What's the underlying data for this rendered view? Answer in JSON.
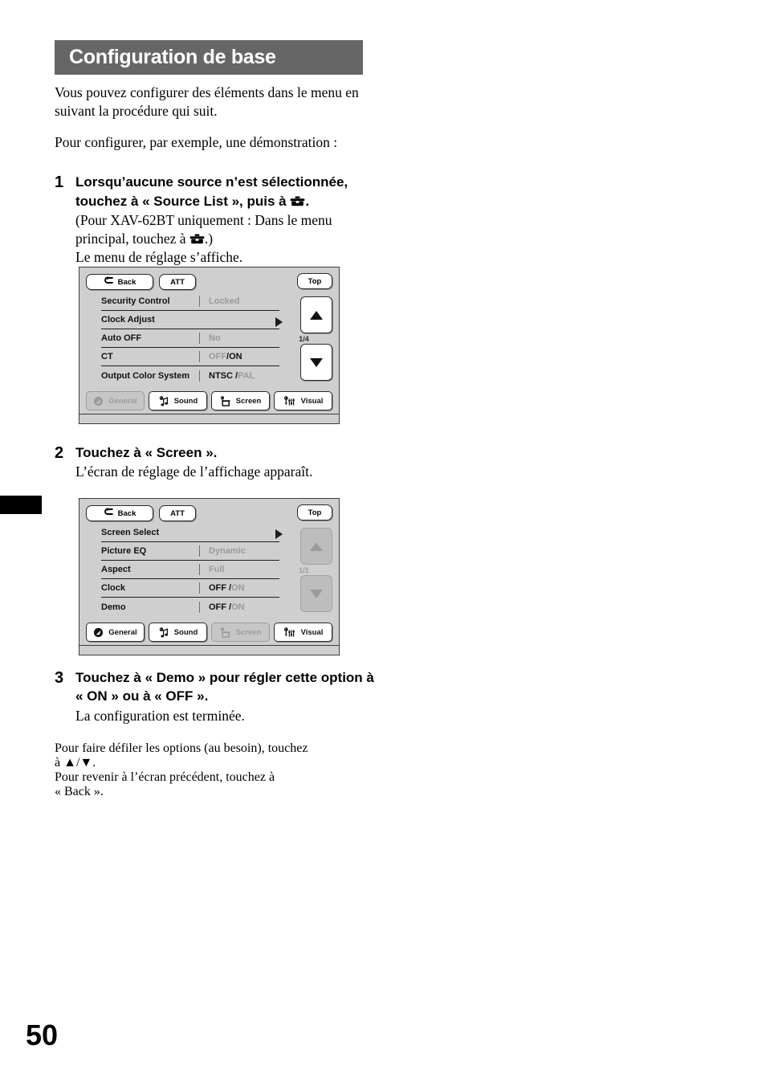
{
  "header": {
    "title": "Configuration de base"
  },
  "intro": {
    "p1": "Vous pouvez configurer des éléments dans le menu en suivant la procédure qui suit.",
    "p2": "Pour configurer, par exemple, une démonstration :"
  },
  "steps": [
    {
      "num": "1",
      "head_a": "Lorsqu’aucune source n’est sélectionnée, touchez à « Source List », puis à ",
      "head_b": ".",
      "sub_a": "(Pour XAV-62BT uniquement : Dans le menu principal, touchez à ",
      "sub_b": ".)",
      "sub2": "Le menu de réglage s’affiche."
    },
    {
      "num": "2",
      "head": "Touchez à « Screen ».",
      "sub": "L’écran de réglage de l’affichage apparaît."
    },
    {
      "num": "3",
      "head": "Touchez à « Demo » pour régler cette option à « ON » ou à « OFF ».",
      "sub": "La configuration est terminée."
    }
  ],
  "outro": {
    "l1": "Pour faire défiler les options (au besoin), touchez",
    "l2": "à ▲/▼.",
    "l3": "Pour revenir à l’écran précédent, touchez à",
    "l4": "« Back »."
  },
  "page_number": "50",
  "screen1": {
    "back_label": "Back",
    "att_label": "ATT",
    "top_label": "Top",
    "page_indicator": "1/4",
    "rows": [
      {
        "label": "Security Control",
        "value": "Locked",
        "state": "off",
        "separator": true
      },
      {
        "label": "Clock Adjust",
        "value": "",
        "state": "off",
        "separator": false
      },
      {
        "label": "Auto OFF",
        "value": "No",
        "state": "off",
        "separator": true
      },
      {
        "label": "CT",
        "value_off": "OFF",
        "value_sep": " / ",
        "value_on": "ON",
        "state": "mixed-on-right",
        "separator": true
      },
      {
        "label": "Output Color System",
        "value_on": "NTSC / ",
        "value_off": "PAL",
        "state": "mixed-on-left",
        "separator": true
      }
    ],
    "tabs": [
      {
        "label": "General",
        "icon": "general-icon",
        "selected": true
      },
      {
        "label": "Sound",
        "icon": "sound-icon",
        "selected": false
      },
      {
        "label": "Screen",
        "icon": "screen-icon",
        "selected": false
      },
      {
        "label": "Visual",
        "icon": "visual-icon",
        "selected": false
      }
    ]
  },
  "screen2": {
    "back_label": "Back",
    "att_label": "ATT",
    "top_label": "Top",
    "page_indicator": "1/1",
    "rows": [
      {
        "label": "Screen Select",
        "value": "",
        "state": "off",
        "separator": false
      },
      {
        "label": "Picture EQ",
        "value": "Dynamic",
        "state": "off",
        "separator": true
      },
      {
        "label": "Aspect",
        "value": "Full",
        "state": "off",
        "separator": true
      },
      {
        "label": "Clock",
        "value_on": "OFF / ",
        "value_off": "ON",
        "state": "mixed-on-left",
        "separator": true
      },
      {
        "label": "Demo",
        "value_on": "OFF / ",
        "value_off": "ON",
        "state": "mixed-on-left",
        "separator": true
      }
    ],
    "tabs": [
      {
        "label": "General",
        "icon": "general-icon",
        "selected": false
      },
      {
        "label": "Sound",
        "icon": "sound-icon",
        "selected": false
      },
      {
        "label": "Screen",
        "icon": "screen-icon",
        "selected": true
      },
      {
        "label": "Visual",
        "icon": "visual-icon",
        "selected": false
      }
    ]
  },
  "colors": {
    "header_bar": "#666666",
    "device_bg": "#cfcfcf",
    "device_border": "#3c3c3c",
    "disabled_text": "#9a9a9a"
  }
}
